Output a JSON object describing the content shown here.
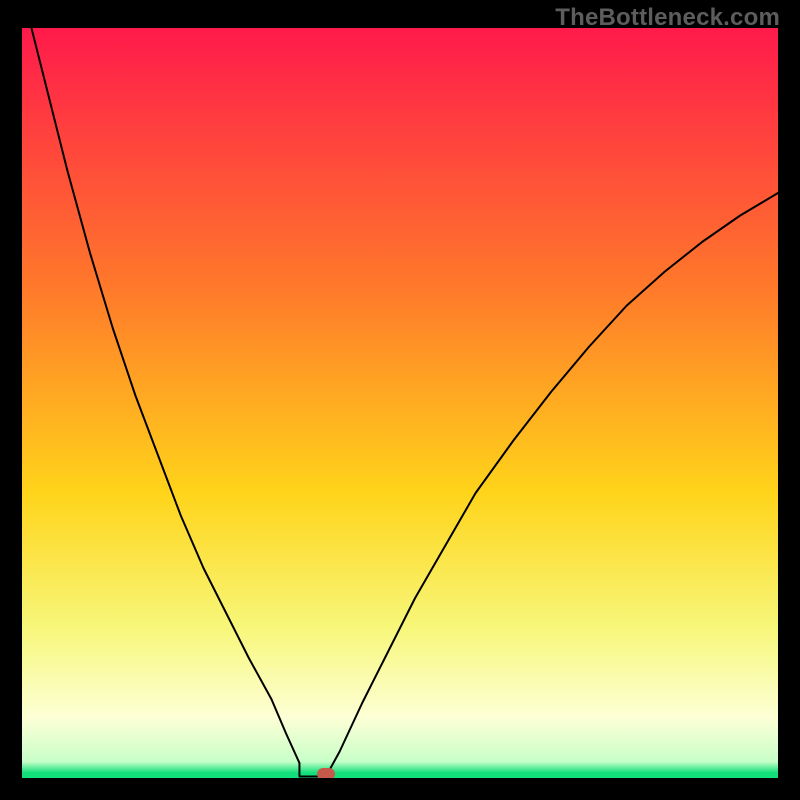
{
  "watermark": "TheBottleneck.com",
  "colors": {
    "top": "#ff1a4b",
    "upper_mid": "#ff7a2a",
    "mid": "#ffd41a",
    "lower_mid": "#f7f77a",
    "pale": "#fdffd6",
    "green": "#12e07a",
    "curve": "#000000",
    "marker": "#c55a4a",
    "frame": "#000000"
  },
  "chart_data": {
    "type": "line",
    "title": "",
    "xlabel": "",
    "ylabel": "",
    "xlim": [
      0,
      100
    ],
    "ylim": [
      0,
      100
    ],
    "series": [
      {
        "name": "left-branch",
        "x": [
          0,
          3,
          6,
          9,
          12,
          15,
          18,
          21,
          24,
          27,
          30,
          33,
          34.9,
          36.7,
          36.7
        ],
        "values": [
          105,
          93,
          81,
          70,
          60,
          51,
          43,
          35,
          28,
          22,
          16,
          10.5,
          6,
          2,
          0.2
        ]
      },
      {
        "name": "floor",
        "x": [
          36.7,
          40.2
        ],
        "values": [
          0.2,
          0.2
        ]
      },
      {
        "name": "right-branch",
        "x": [
          40.2,
          42,
          45,
          48,
          52,
          56,
          60,
          65,
          70,
          75,
          80,
          85,
          90,
          95,
          100
        ],
        "values": [
          0.2,
          3.5,
          10,
          16,
          24,
          31,
          38,
          45,
          51.5,
          57.5,
          63,
          67.5,
          71.5,
          75,
          78
        ]
      }
    ],
    "marker": {
      "x": 40.2,
      "y": 0.6
    },
    "gradient_stops": [
      {
        "pct": 0,
        "color": "#ff1a4b"
      },
      {
        "pct": 35,
        "color": "#ff7a2a"
      },
      {
        "pct": 62,
        "color": "#ffd41a"
      },
      {
        "pct": 80,
        "color": "#f7f77a"
      },
      {
        "pct": 92,
        "color": "#fdffd6"
      },
      {
        "pct": 97.8,
        "color": "#c8ffc8"
      },
      {
        "pct": 99.3,
        "color": "#12e07a"
      },
      {
        "pct": 100,
        "color": "#12e07a"
      }
    ]
  }
}
